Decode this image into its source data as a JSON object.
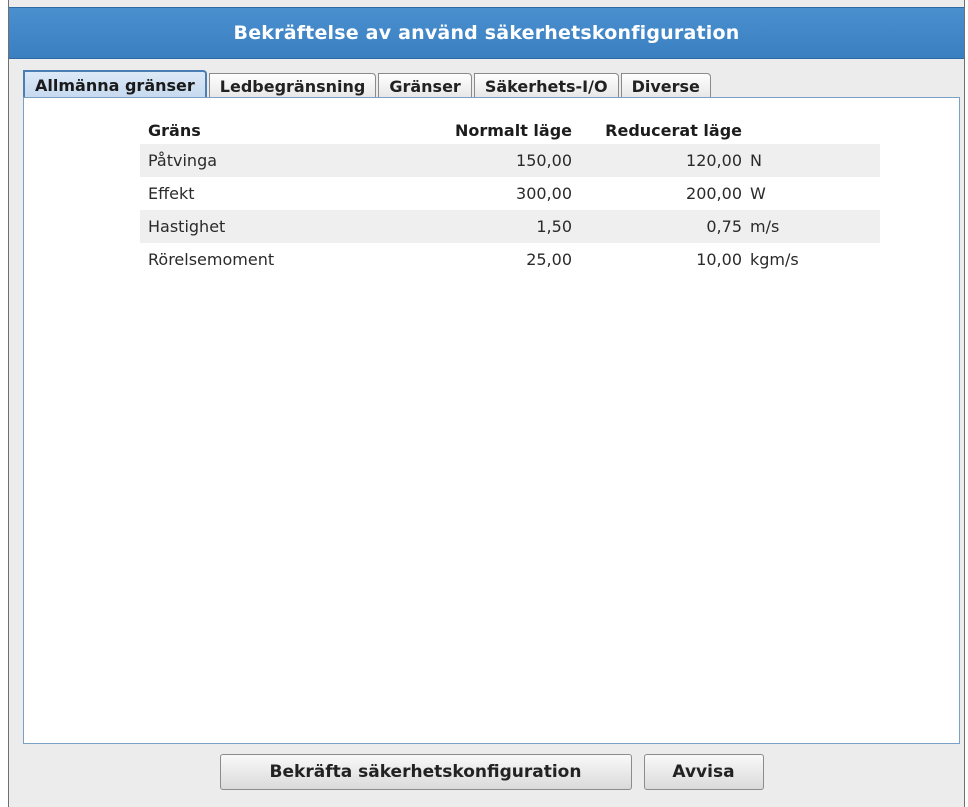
{
  "dialog": {
    "title": "Bekräftelse av använd säkerhetskonfiguration"
  },
  "tabs": [
    {
      "label": "Allmänna gränser",
      "active": true
    },
    {
      "label": "Ledbegränsning",
      "active": false
    },
    {
      "label": "Gränser",
      "active": false
    },
    {
      "label": "Säkerhets-I/O",
      "active": false
    },
    {
      "label": "Diverse",
      "active": false
    }
  ],
  "table": {
    "headers": {
      "limit": "Gräns",
      "normal": "Normalt läge",
      "reduced": "Reducerat läge"
    },
    "rows": [
      {
        "name": "Påtvinga",
        "normal": "150,00",
        "reduced": "120,00",
        "unit": "N"
      },
      {
        "name": "Effekt",
        "normal": "300,00",
        "reduced": "200,00",
        "unit": "W"
      },
      {
        "name": "Hastighet",
        "normal": "1,50",
        "reduced": "0,75",
        "unit": "m/s"
      },
      {
        "name": "Rörelsemoment",
        "normal": "25,00",
        "reduced": "10,00",
        "unit": "kgm/s"
      }
    ]
  },
  "buttons": {
    "confirm_label": "Bekräfta säkerhetskonfiguration",
    "reject_label": "Avvisa"
  }
}
